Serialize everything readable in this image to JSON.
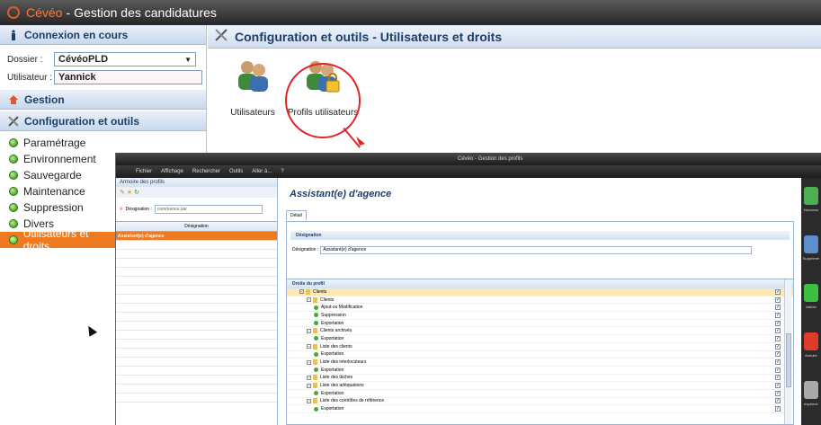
{
  "window": {
    "app_name": "Cévéo",
    "separator": " - ",
    "title": "Gestion des candidatures"
  },
  "left": {
    "connexion": {
      "header": "Connexion en cours",
      "dossier_label": "Dossier :",
      "dossier_value": "CévéoPLD",
      "user_label": "Utilisateur :",
      "user_value": "Yannick"
    },
    "gestion": "Gestion",
    "config": "Configuration et outils",
    "items": [
      {
        "label": "Paramétrage"
      },
      {
        "label": "Environnement"
      },
      {
        "label": "Sauvegarde"
      },
      {
        "label": "Maintenance"
      },
      {
        "label": "Suppression"
      },
      {
        "label": "Divers"
      },
      {
        "label": "Utilisateurs et droits",
        "active": true
      }
    ]
  },
  "main": {
    "title": "Configuration et outils - Utilisateurs et droits",
    "tiles": [
      {
        "label": "Utilisateurs"
      },
      {
        "label": "Profils utilisateurs"
      }
    ]
  },
  "inner": {
    "title": "Cévéo - Gestion des profils",
    "menu": [
      "Fichier",
      "Affichage",
      "Rechercher",
      "Outils",
      "Aller à...",
      "?"
    ],
    "left_header": "Armoire des profils",
    "search_label": "Désignation :",
    "search_placeholder": "commence par",
    "grid_header": "Désignation",
    "selected_profile": "Assistant(e) d'agence",
    "profile_title": "Assistant(e) d'agence",
    "tab": "Détail",
    "designation_group": "Désignation",
    "designation_label": "Désignation :",
    "designation_value": "Assistant(e) d'agence",
    "rights_group": "Droits du profil",
    "tree": [
      {
        "label": "Clients",
        "level": 0,
        "hl": true
      },
      {
        "label": "Clients",
        "level": 1
      },
      {
        "label": "Ajout ou Modification",
        "level": 2
      },
      {
        "label": "Suppression",
        "level": 2
      },
      {
        "label": "Exportation",
        "level": 2
      },
      {
        "label": "Clients archivés",
        "level": 1
      },
      {
        "label": "Exportation",
        "level": 2
      },
      {
        "label": "Liste des clients",
        "level": 1
      },
      {
        "label": "Exportation",
        "level": 2
      },
      {
        "label": "Liste des interlocuteurs",
        "level": 1
      },
      {
        "label": "Exportation",
        "level": 2
      },
      {
        "label": "Liste des tâches",
        "level": 1
      },
      {
        "label": "Liste des adéquations",
        "level": 1
      },
      {
        "label": "Exportation",
        "level": 2
      },
      {
        "label": "Liste des contrôles de référence",
        "level": 1
      },
      {
        "label": "Exportation",
        "level": 2
      }
    ],
    "side_buttons": [
      "Nouveau",
      "Supprimer",
      "Valider",
      "Annuler",
      "Imprimer"
    ]
  }
}
